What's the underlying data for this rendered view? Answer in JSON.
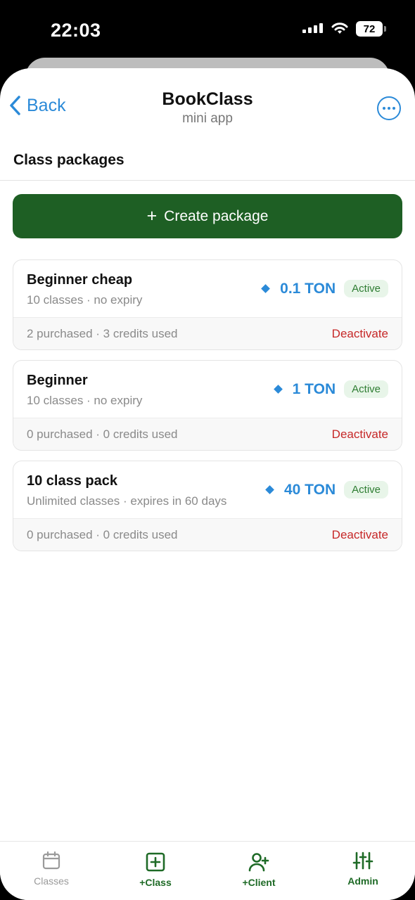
{
  "status_bar": {
    "time": "22:03",
    "battery": "72"
  },
  "header": {
    "back_label": "Back",
    "title": "BookClass",
    "subtitle": "mini app"
  },
  "section": {
    "title": "Class packages"
  },
  "create_button": {
    "icon": "+",
    "label": "Create package"
  },
  "packages": [
    {
      "name": "Beginner cheap",
      "meta": "10 classes · no expiry",
      "price": "0.1 TON",
      "status": "Active",
      "stats": "2 purchased · 3 credits used",
      "action": "Deactivate"
    },
    {
      "name": "Beginner",
      "meta": "10 classes · no expiry",
      "price": "1 TON",
      "status": "Active",
      "stats": "0 purchased · 0 credits used",
      "action": "Deactivate"
    },
    {
      "name": "10 class pack",
      "meta": "Unlimited classes · expires in 60 days",
      "price": "40 TON",
      "status": "Active",
      "stats": "0 purchased · 0 credits used",
      "action": "Deactivate"
    }
  ],
  "tabbar": {
    "items": [
      {
        "label": "Classes",
        "icon": "calendar-icon"
      },
      {
        "label": "+Class",
        "icon": "plus-square-icon"
      },
      {
        "label": "+Client",
        "icon": "add-user-icon"
      },
      {
        "label": "Admin",
        "icon": "sliders-icon"
      }
    ]
  },
  "colors": {
    "accent": "#2b8ad8",
    "primary_button": "#1e5f24",
    "danger": "#c62828",
    "badge_bg": "#e8f5e9",
    "badge_text": "#2e7d32"
  }
}
